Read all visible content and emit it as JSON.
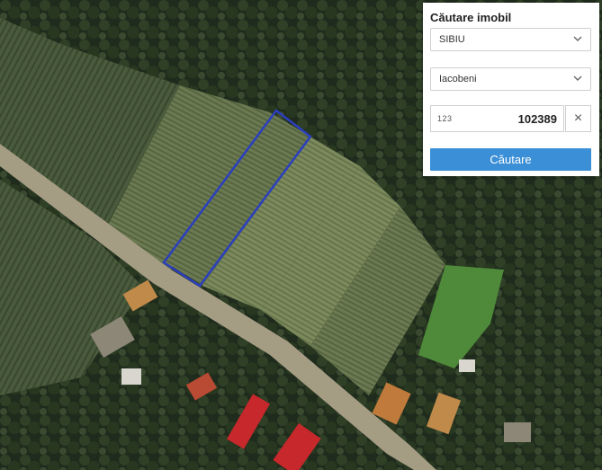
{
  "panel": {
    "title": "Căutare imobil",
    "county": "SIBIU",
    "locality": "Iacobeni",
    "search_icon_label": "123",
    "cadastral_number": "102389",
    "clear_label": "×",
    "submit_label": "Căutare"
  },
  "icons": {
    "county_chevron": "chevron-down-icon",
    "locality_chevron": "chevron-down-icon",
    "clear": "close-icon"
  },
  "colors": {
    "parcel_outline": "#2b3fbf",
    "submit_button": "#3a8fd6"
  }
}
